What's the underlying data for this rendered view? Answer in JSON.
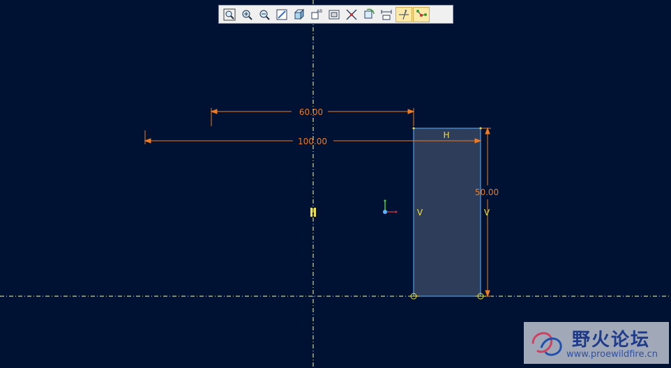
{
  "toolbar": {
    "buttons": [
      {
        "name": "refit-button",
        "icon": "refit-icon"
      },
      {
        "name": "zoom-in-button",
        "icon": "zoom-in-icon"
      },
      {
        "name": "zoom-out-button",
        "icon": "zoom-out-icon"
      },
      {
        "name": "repaint-button",
        "icon": "repaint-icon"
      },
      {
        "name": "display-style-button",
        "icon": "cube-shaded-icon"
      },
      {
        "name": "saved-views-button",
        "icon": "saved-views-icon"
      },
      {
        "name": "sketch-view-button",
        "icon": "sketch-view-icon"
      },
      {
        "name": "datum-display-button",
        "icon": "datum-display-icon"
      },
      {
        "name": "spin-center-button",
        "icon": "spin-center-icon"
      },
      {
        "name": "dimension-display-button",
        "icon": "dimension-display-icon"
      },
      {
        "name": "constraint-display-button",
        "icon": "constraint-display-icon",
        "active": true
      },
      {
        "name": "vertex-display-button",
        "icon": "vertex-display-icon",
        "active": true
      }
    ]
  },
  "sketch": {
    "dimensions": {
      "dim_60": "60.00",
      "dim_100": "100.00",
      "dim_50": "50.00"
    },
    "constraints": {
      "horizontal": "H",
      "vertical_left": "V",
      "vertical_right": "V"
    }
  },
  "colors": {
    "background": "#001233",
    "dimension": "#f07a1e",
    "centerline": "#ffffa0",
    "sketch_fill": "#2e3d5a",
    "sketch_edge": "#5ab4ff",
    "constraint": "#f0e040"
  },
  "watermark": {
    "title": "野火论坛",
    "url": "www.proewildfire.cn"
  }
}
